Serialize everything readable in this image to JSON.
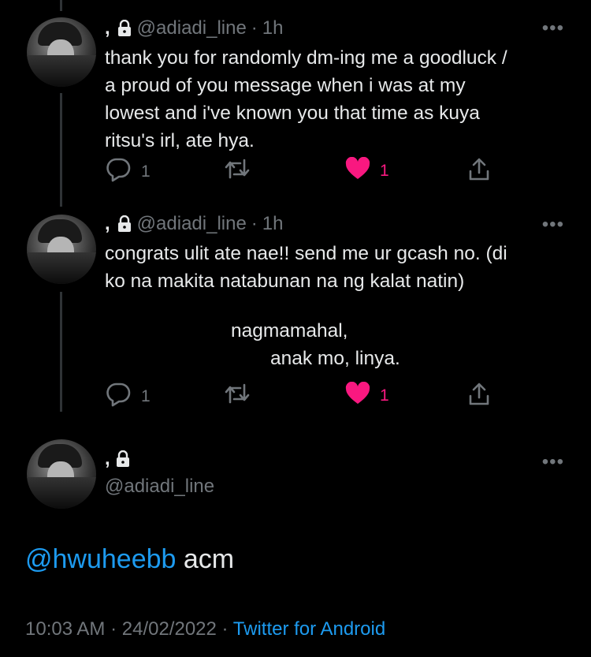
{
  "tweets": [
    {
      "name": ",",
      "handle": "@adiadi_line",
      "sep": "·",
      "time": "1h",
      "more": "•••",
      "lines": [
        "thank you for randomly dm-ing me a goodluck /",
        "a proud of you message when i was at my",
        "lowest and i've known you that time as kuya",
        "ritsu's irl, ate hya."
      ],
      "reply_count": "1",
      "like_count": "1"
    },
    {
      "name": ",",
      "handle": "@adiadi_line",
      "sep": "·",
      "time": "1h",
      "more": "•••",
      "lines": [
        "congrats ulit ate nae!! send me ur gcash no. (di",
        "ko na makita natabunan na ng kalat natin)"
      ],
      "signature": [
        "nagmamahal,",
        "anak mo, linya."
      ],
      "reply_count": "1",
      "like_count": "1"
    }
  ],
  "main": {
    "name": ",",
    "handle": "@adiadi_line",
    "more": "•••",
    "mention": "@hwuheebb",
    "text": " acm",
    "time": "10:03 AM",
    "sep1": "·",
    "date": "24/02/2022",
    "sep2": "·",
    "source": "Twitter for Android"
  },
  "colors": {
    "background": "#000000",
    "text": "#e7e9ea",
    "muted": "#71767b",
    "accent_blue": "#1d9bf0",
    "like_pink": "#f91880",
    "thread_line": "#2f3336"
  },
  "icons": [
    "lock-icon",
    "more-icon",
    "reply-icon",
    "retweet-icon",
    "like-icon",
    "share-icon"
  ]
}
